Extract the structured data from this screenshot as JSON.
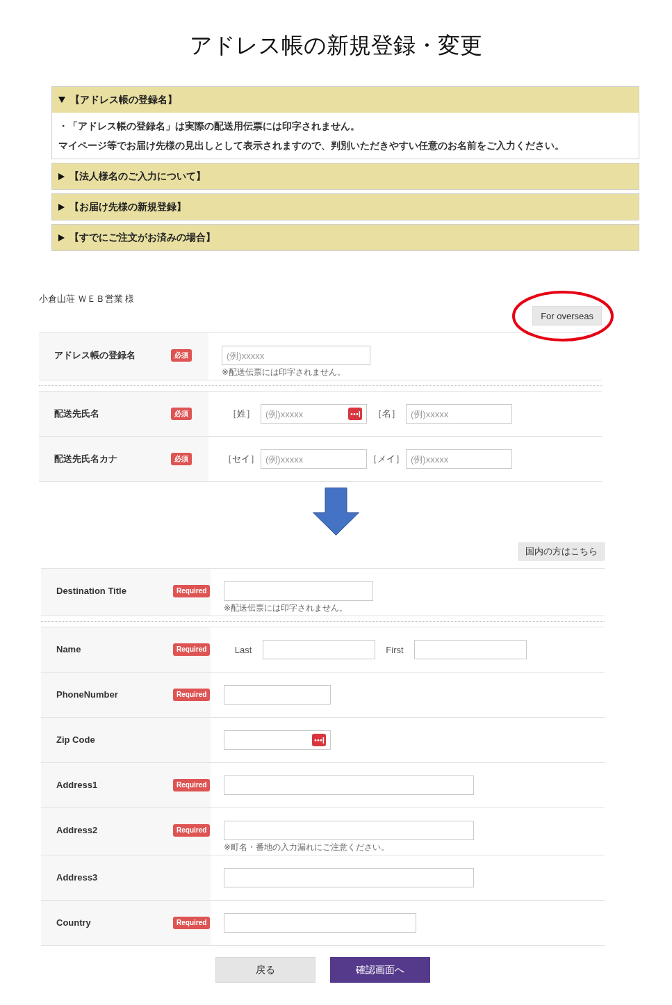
{
  "page": {
    "title": "アドレス帳の新規登録・変更"
  },
  "accordion": [
    {
      "title": "【アドレス帳の登録名】",
      "expanded": true,
      "body": [
        "・「アドレス帳の登録名」は実際の配送用伝票には印字されません。",
        "マイページ等でお届け先様の見出しとして表示されますので、判別いただきやすい任意のお名前をご入力ください。"
      ]
    },
    {
      "title": "【法人様名のご入力について】",
      "expanded": false
    },
    {
      "title": "【お届け先様の新規登録】",
      "expanded": false
    },
    {
      "title": "【すでにご注文がお済みの場合】",
      "expanded": false
    }
  ],
  "customer_name": "小倉山荘 ＷＥＢ営業 様",
  "forms": [
    {
      "switch_button": {
        "label": "For overseas",
        "circled": true
      },
      "sections": [
        {
          "rows": [
            {
              "label": "アドレス帳の登録名",
              "badge": "必須",
              "fields": [
                {
                  "placeholder": "(例)xxxxx"
                }
              ],
              "note": "※配送伝票には印字されません。"
            }
          ]
        },
        {
          "rows": [
            {
              "label": "配送先氏名",
              "badge": "必須",
              "fields": [
                {
                  "prefix": "［姓］",
                  "placeholder": "(例)xxxxx",
                  "dots_icon": true
                },
                {
                  "prefix": "［名］",
                  "placeholder": "(例)xxxxx"
                }
              ]
            },
            {
              "label": "配送先氏名カナ",
              "badge": "必須",
              "fields": [
                {
                  "prefix": "［セイ］",
                  "placeholder": "(例)xxxxx"
                },
                {
                  "prefix": "［メイ］",
                  "placeholder": "(例)xxxxx"
                }
              ]
            }
          ]
        }
      ]
    },
    {
      "switch_button": {
        "label": "国内の方はこちら",
        "circled": false
      },
      "sections": [
        {
          "rows": [
            {
              "label": "Destination Title",
              "badge": "Required",
              "note": "※配送伝票には印字されません。"
            }
          ]
        },
        {
          "rows": [
            {
              "label": "Name",
              "badge": "Required",
              "fields": [
                {
                  "prefix": "Last"
                },
                {
                  "prefix": "First"
                }
              ]
            },
            {
              "label": "PhoneNumber",
              "badge": "Required"
            },
            {
              "label": "Zip Code",
              "fields": [
                {
                  "dots_icon": true
                }
              ]
            },
            {
              "label": "Address1",
              "badge": "Required"
            },
            {
              "label": "Address2",
              "badge": "Required",
              "note": "※町名・番地の入力漏れにご注意ください。"
            },
            {
              "label": "Address3"
            },
            {
              "label": "Country",
              "badge": "Required"
            }
          ]
        }
      ]
    }
  ],
  "buttons": [
    {
      "label": "戻る",
      "kind": "secondary"
    },
    {
      "label": "確認画面へ",
      "kind": "primary"
    }
  ]
}
